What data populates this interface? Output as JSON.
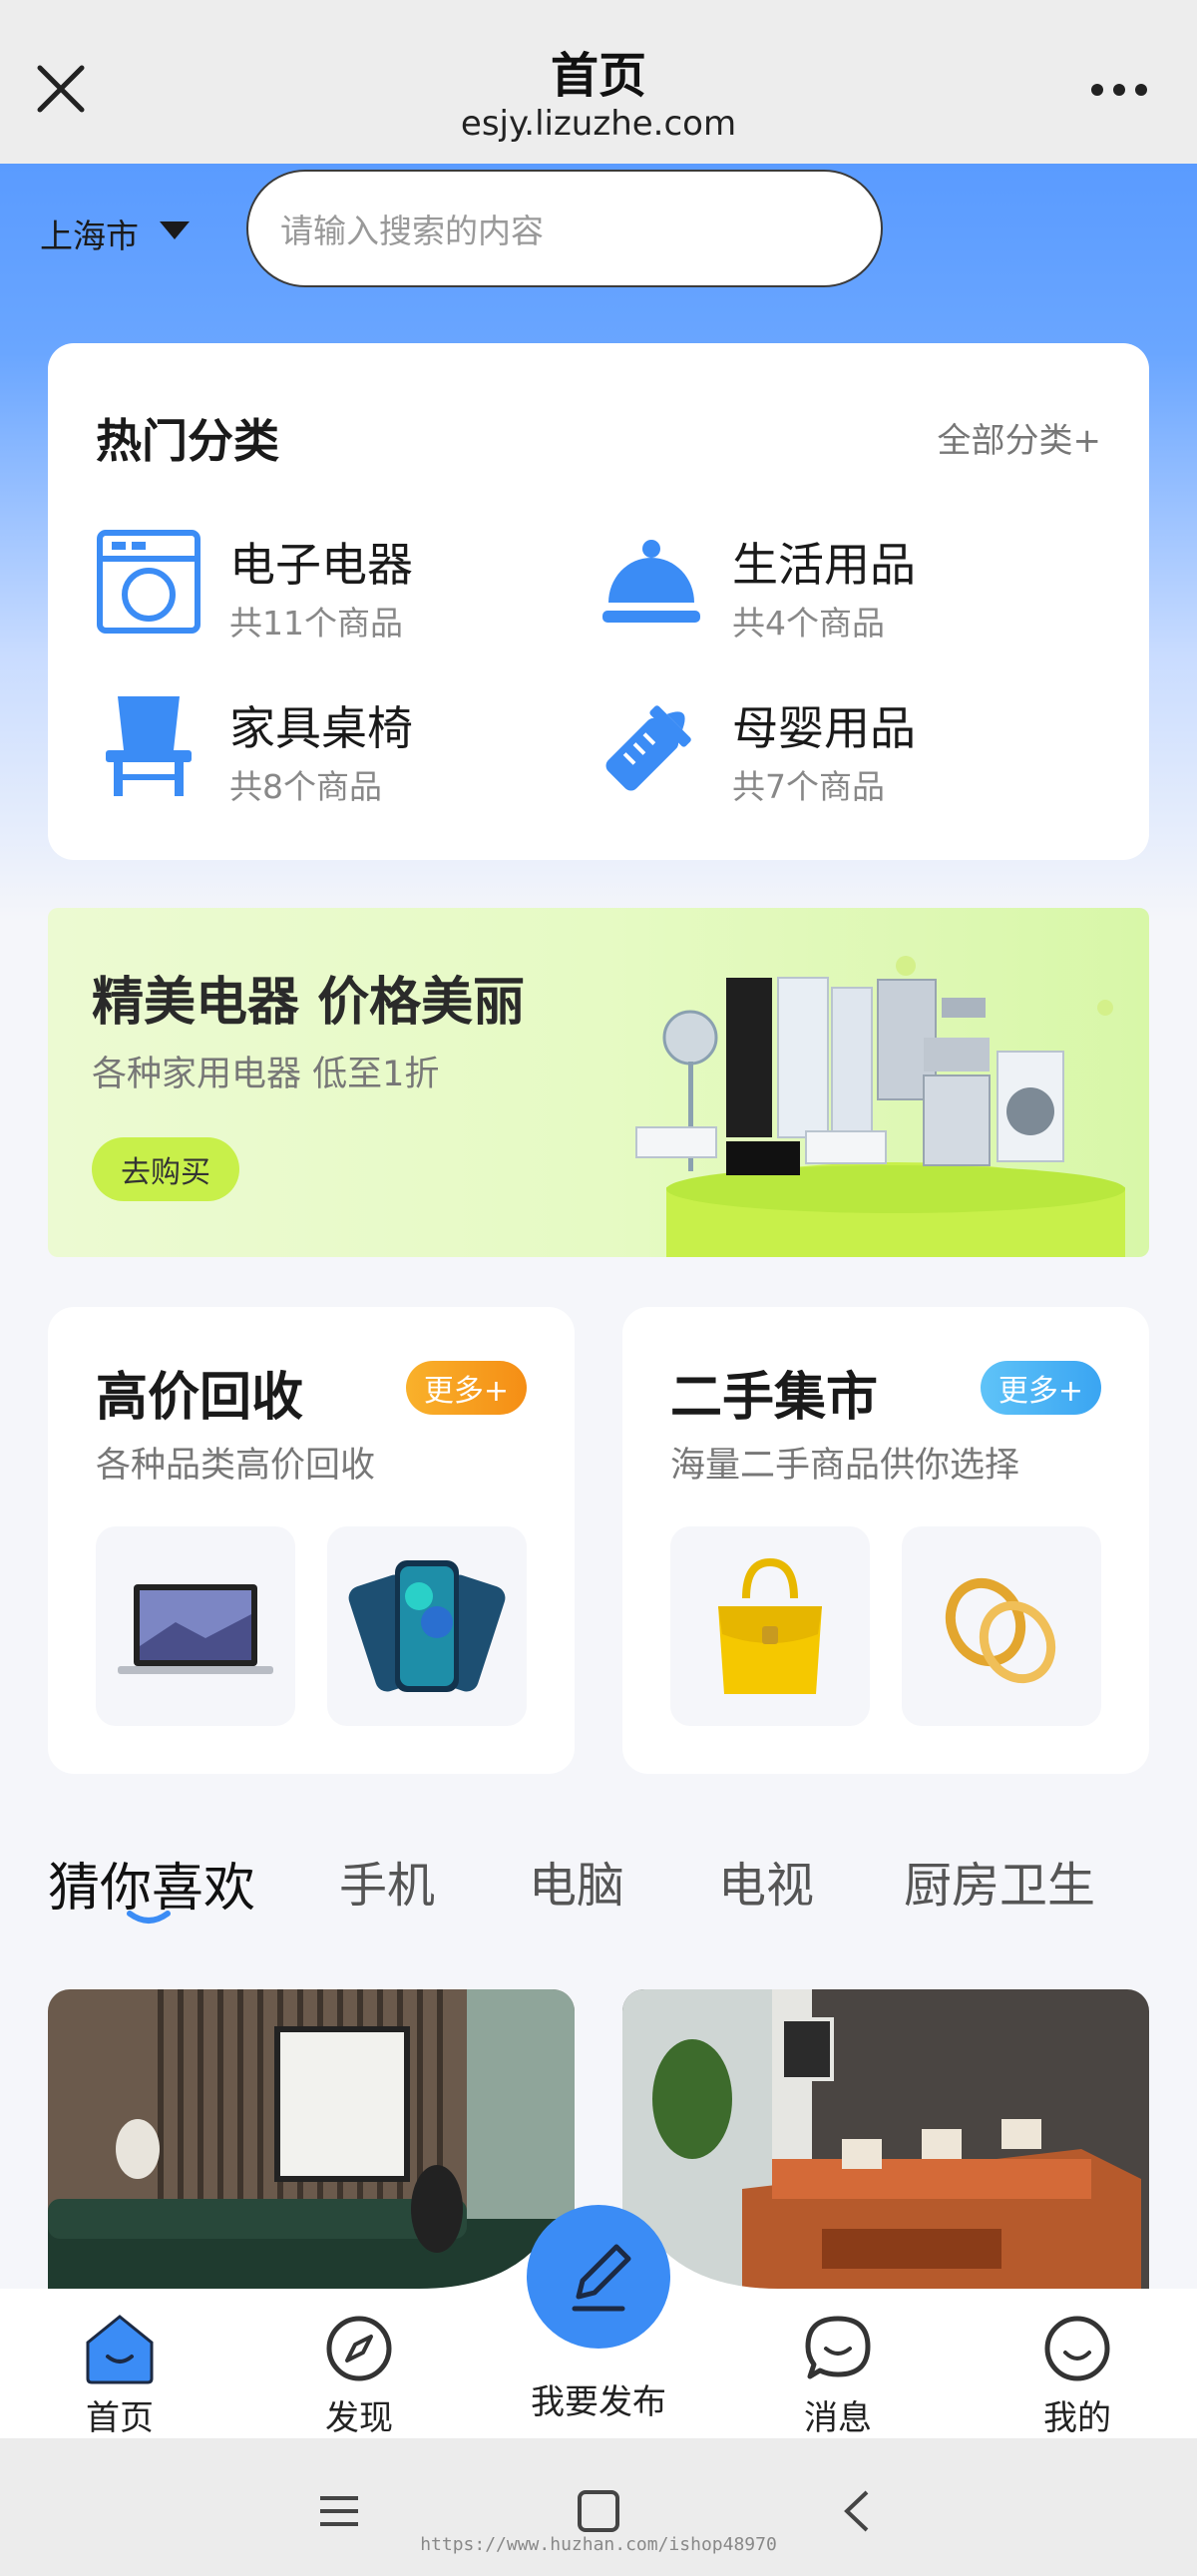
{
  "browser": {
    "title": "首页",
    "url": "esjy.lizuzhe.com"
  },
  "header": {
    "city": "上海市",
    "search_placeholder": "请输入搜索的内容"
  },
  "categories": {
    "title": "热门分类",
    "all_link": "全部分类+",
    "items": [
      {
        "name": "电子电器",
        "count": "共11个商品",
        "icon": "washing-machine-icon"
      },
      {
        "name": "生活用品",
        "count": "共4个商品",
        "icon": "service-bell-icon"
      },
      {
        "name": "家具桌椅",
        "count": "共8个商品",
        "icon": "chair-icon"
      },
      {
        "name": "母婴用品",
        "count": "共7个商品",
        "icon": "baby-bottle-icon"
      }
    ]
  },
  "banner": {
    "title": "精美电器 价格美丽",
    "subtitle": "各种家用电器 低至1折",
    "button": "去购买"
  },
  "features": [
    {
      "title": "高价回收",
      "subtitle": "各种品类高价回收",
      "more": "更多+",
      "accent": "#f7a21b"
    },
    {
      "title": "二手集市",
      "subtitle": "海量二手商品供你选择",
      "more": "更多+",
      "accent": "#4fb3f6"
    }
  ],
  "tabs": [
    "猜你喜欢",
    "手机",
    "电脑",
    "电视",
    "厨房卫生"
  ],
  "nav": [
    {
      "label": "首页",
      "icon": "home-icon"
    },
    {
      "label": "发现",
      "icon": "compass-icon"
    },
    {
      "label": "我要发布",
      "icon": "pen-icon"
    },
    {
      "label": "消息",
      "icon": "chat-icon"
    },
    {
      "label": "我的",
      "icon": "profile-icon"
    }
  ],
  "watermark": "https://www.huzhan.com/ishop48970",
  "colors": {
    "primary": "#3b8cf5",
    "accent_orange": "#f7a21b",
    "accent_blue": "#4fb3f6",
    "banner_button": "#c8f04a"
  }
}
